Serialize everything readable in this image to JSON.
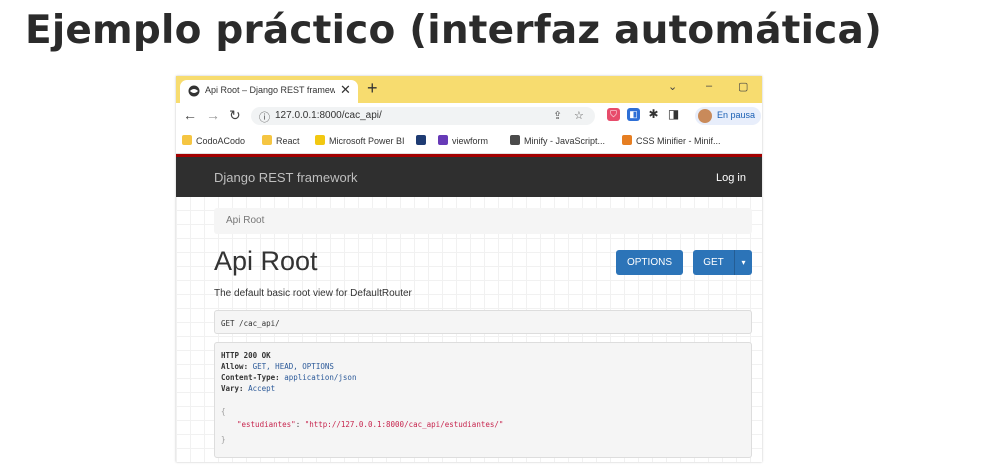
{
  "slide": {
    "title": "Ejemplo práctico (interfaz automática)"
  },
  "browser": {
    "tab": {
      "title": "Api Root – Django REST framew...",
      "close": "✕"
    },
    "new_tab": "+",
    "window": {
      "chevron": "⌄",
      "minimize": "–",
      "maximize": "▢"
    },
    "address": {
      "url": "127.0.0.1:8000/cac_api/"
    },
    "profile": {
      "label": "En pausa"
    },
    "bookmarks": [
      {
        "label": "CodoACodo",
        "color": "#f5c542"
      },
      {
        "label": "React",
        "color": "#f5c542"
      },
      {
        "label": "Microsoft Power BI",
        "color": "#f2c811"
      },
      {
        "label": "",
        "color": "#1f3b73"
      },
      {
        "label": "viewform",
        "color": "#673ab7"
      },
      {
        "label": "Minify - JavaScript...",
        "color": "#4a4a4a"
      },
      {
        "label": "CSS Minifier - Minif...",
        "color": "#e67e22"
      }
    ]
  },
  "drf": {
    "brand": "Django REST framework",
    "login": "Log in",
    "breadcrumb": "Api Root",
    "heading": "Api Root",
    "options_button": "OPTIONS",
    "get_button": "GET",
    "get_caret": "▾",
    "description": "The default basic root view for DefaultRouter",
    "request": "GET /cac_api/",
    "response": {
      "status": "HTTP 200 OK",
      "allow_key": "Allow:",
      "allow_val": "GET, HEAD, OPTIONS",
      "ctype_key": "Content-Type:",
      "ctype_val": "application/json",
      "vary_key": "Vary:",
      "vary_val": "Accept",
      "open_brace": "{",
      "json_key": "\"estudiantes\"",
      "json_colon": ": ",
      "json_val": "\"http://127.0.0.1:8000/cac_api/estudiantes/\"",
      "close_brace": "}"
    }
  }
}
